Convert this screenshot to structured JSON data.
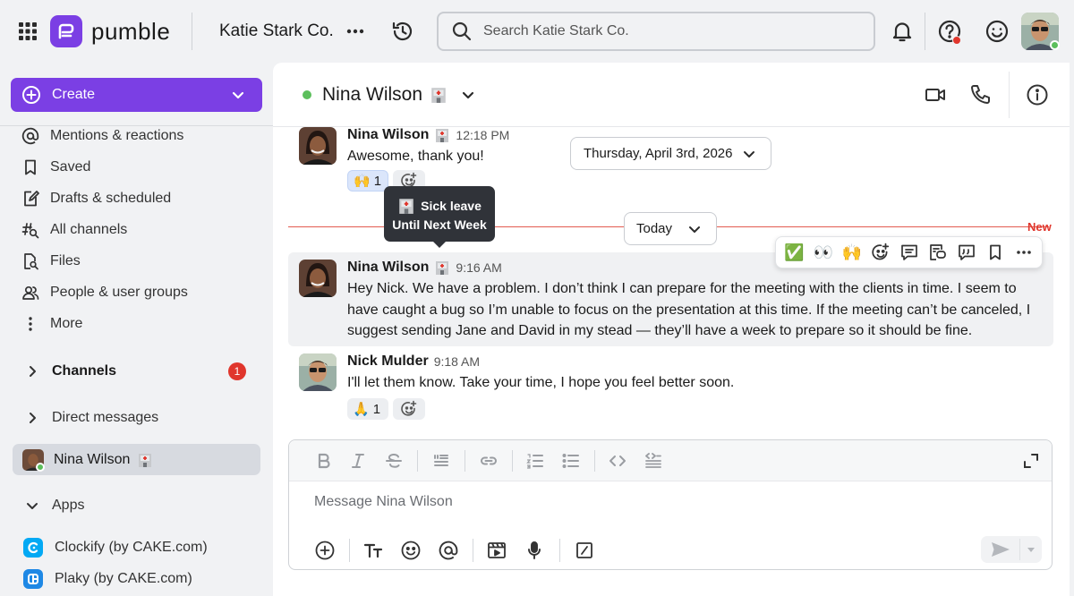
{
  "app": {
    "logo_text": "pumble",
    "workspace": "Katie Stark Co."
  },
  "search": {
    "placeholder": "Search Katie Stark Co."
  },
  "sidebar": {
    "create_label": "Create",
    "nav": [
      {
        "label": "Mentions & reactions",
        "icon": "at-icon"
      },
      {
        "label": "Saved",
        "icon": "bookmark-icon"
      },
      {
        "label": "Drafts & scheduled",
        "icon": "draft-icon"
      },
      {
        "label": "All channels",
        "icon": "channels-search-icon"
      },
      {
        "label": "Files",
        "icon": "file-search-icon"
      },
      {
        "label": "People & user groups",
        "icon": "people-icon"
      },
      {
        "label": "More",
        "icon": "more-vertical-icon"
      }
    ],
    "channels_label": "Channels",
    "channels_badge": "1",
    "direct_messages_label": "Direct messages",
    "active_dm": "Nina Wilson",
    "apps_label": "Apps",
    "apps": [
      {
        "label": "Clockify (by CAKE.com)",
        "color": "#03a9f4"
      },
      {
        "label": "Plaky (by CAKE.com)",
        "color": "#1e88e5"
      }
    ]
  },
  "conversation": {
    "title": "Nina Wilson",
    "date_pill": "Thursday, April 3rd, 2026",
    "today_pill": "Today",
    "new_label": "New",
    "tooltip_line1": "Sick leave",
    "tooltip_line2": "Until Next Week",
    "messages": [
      {
        "author": "Nina Wilson",
        "time": "12:18 PM",
        "text": "Awesome, thank you!",
        "reaction": {
          "emoji": "🙌",
          "count": "1"
        }
      },
      {
        "author": "Nina Wilson",
        "time": "9:16 AM",
        "text": "Hey Nick. We have a problem. I don’t think I can prepare for the meeting with the clients in time. I seem to have caught a bug so I’m unable to focus on the presentation at this time. If the meeting can’t be canceled, I suggest sending Jane and David in my stead — they’ll have a week to prepare so it should be fine."
      },
      {
        "author": "Nick Mulder",
        "time": "9:18 AM",
        "text": "I'll let them know. Take your time, I hope you feel better soon.",
        "reaction": {
          "emoji": "🙏",
          "count": "1"
        }
      }
    ],
    "action_emojis": [
      "✅",
      "👀",
      "🙌"
    ]
  },
  "composer": {
    "placeholder": "Message Nina Wilson"
  },
  "colors": {
    "accent": "#7b3fe4",
    "online": "#5cbf5c",
    "alert": "#e0362c"
  }
}
